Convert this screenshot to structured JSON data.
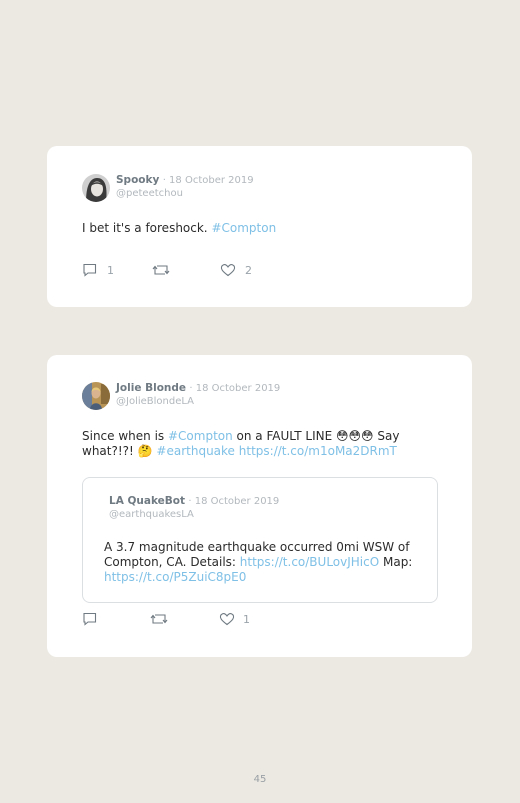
{
  "tweets": [
    {
      "name": "Spooky",
      "date": "· 18 October 2019",
      "handle": "@peteetchou",
      "text_before": "I bet it's a foreshock. ",
      "hashtag": "#Compton",
      "replies": "1",
      "retweets": "",
      "likes": "2"
    },
    {
      "name": "Jolie Blonde",
      "date": "· 18 October 2019",
      "handle": "@JolieBlondeLA",
      "text_1": "Since when is ",
      "hashtag_1": "#Compton",
      "text_2": " on a FAULT LINE 😳😳😳 Say what?!?! 🤔 ",
      "hashtag_2": "#earthquake",
      "text_3": " ",
      "link": "https://t.co/m1oMa2DRmT",
      "replies": "",
      "retweets": "",
      "likes": "1",
      "quoted": {
        "name": "LA QuakeBot",
        "date": "· 18 October 2019",
        "handle": "@earthquakesLA",
        "text_1": "A 3.7 magnitude earthquake occurred 0mi WSW of Compton, CA. Details: ",
        "link_1": "https://t.co/BULovJHicO",
        "text_2": " Map: ",
        "link_2": "https://t.co/P5ZuiC8pE0"
      }
    }
  ],
  "page_number": "45",
  "icons": [
    "reply-icon",
    "retweet-icon",
    "like-icon"
  ],
  "colors": {
    "background": "#ece9e2",
    "card": "#ffffff",
    "link": "#7fc0e6",
    "name": "#6f7a82",
    "muted": "#b2b8bd"
  }
}
